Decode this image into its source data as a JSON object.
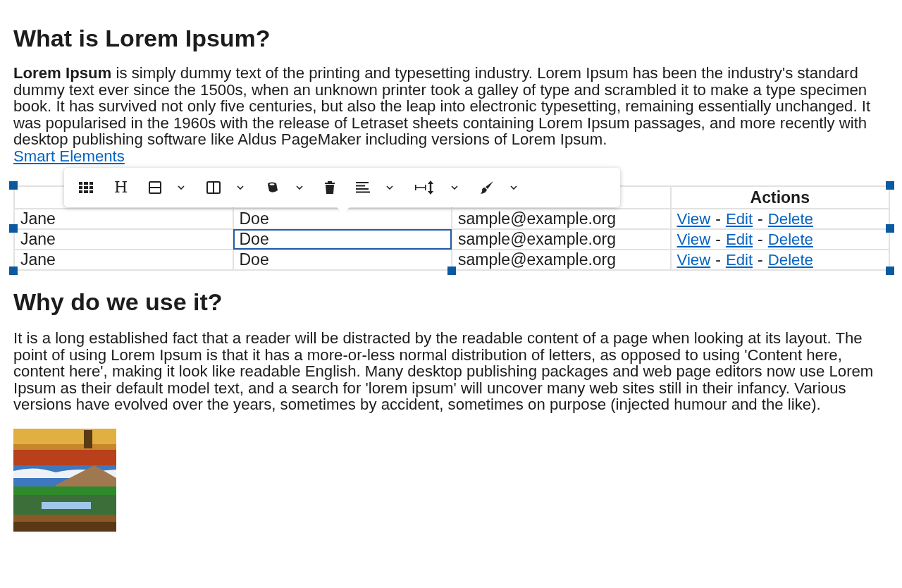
{
  "heading_1": "What is Lorem Ipsum?",
  "paragraph_1": "**Lorem Ipsum** is simply dummy text of the printing and typesetting industry. Lorem Ipsum has been the industry's standard dummy text ever since the 1500s, when an unknown printer took a galley of type and scrambled it to make a type specimen book. It has survived not only five centuries, but also the leap into electronic typesetting, remaining essentially unchanged. It was popularised in the 1960s with the release of Letraset sheets containing Lorem Ipsum passages, and more recently with desktop publishing software like Aldus PageMaker including versions of Lorem Ipsum.",
  "link": "Smart Elements",
  "table": {
    "columns": [
      "",
      "",
      "",
      "Actions"
    ],
    "rows": [
      {
        "cells": [
          {
            "text": "Jane",
            "selected": false
          },
          {
            "text": "Doe",
            "selected": false
          },
          {
            "text": "sample@example.org",
            "selected": false
          }
        ],
        "actions": [
          "View",
          "Edit",
          "Delete"
        ],
        "separators": [
          "-",
          "-"
        ]
      },
      {
        "cells": [
          {
            "text": "Jane",
            "selected": false
          },
          {
            "text": "Doe",
            "selected": true
          },
          {
            "text": "sample@example.org",
            "selected": false
          }
        ],
        "actions": [
          "View",
          "Edit",
          "Delete"
        ],
        "separators": [
          "-",
          "-"
        ]
      },
      {
        "cells": [
          {
            "text": "Jane",
            "selected": false
          },
          {
            "text": "Doe",
            "selected": false
          },
          {
            "text": "sample@example.org",
            "selected": false
          }
        ],
        "actions": [
          "View",
          "Edit",
          "Delete"
        ],
        "separators": [
          "-",
          "-"
        ]
      }
    ]
  },
  "toolbar": [
    {
      "dropdown": false
    },
    {
      "label": "H",
      "dropdown": false
    },
    {
      "dropdown": true
    },
    {
      "dropdown": true
    },
    {
      "dropdown": true
    },
    {
      "dropdown": false
    },
    {
      "dropdown": true
    },
    {
      "dropdown": true
    },
    {
      "dropdown": true
    }
  ],
  "heading_2": "Why do we use it?",
  "paragraph_2": "It is a long established fact that a reader will be distracted by the readable content of a page when looking at its layout. The point of using Lorem Ipsum is that it has a more-or-less normal distribution of letters, as opposed to using 'Content here, content here', making it look like readable English. Many desktop publishing packages and web page editors now use Lorem Ipsum as their default model text, and a search for 'lorem ipsum' will uncover many web sites still in their infancy. Various versions have evolved over the years, sometimes by accident, sometimes on purpose (injected humour and the like)."
}
